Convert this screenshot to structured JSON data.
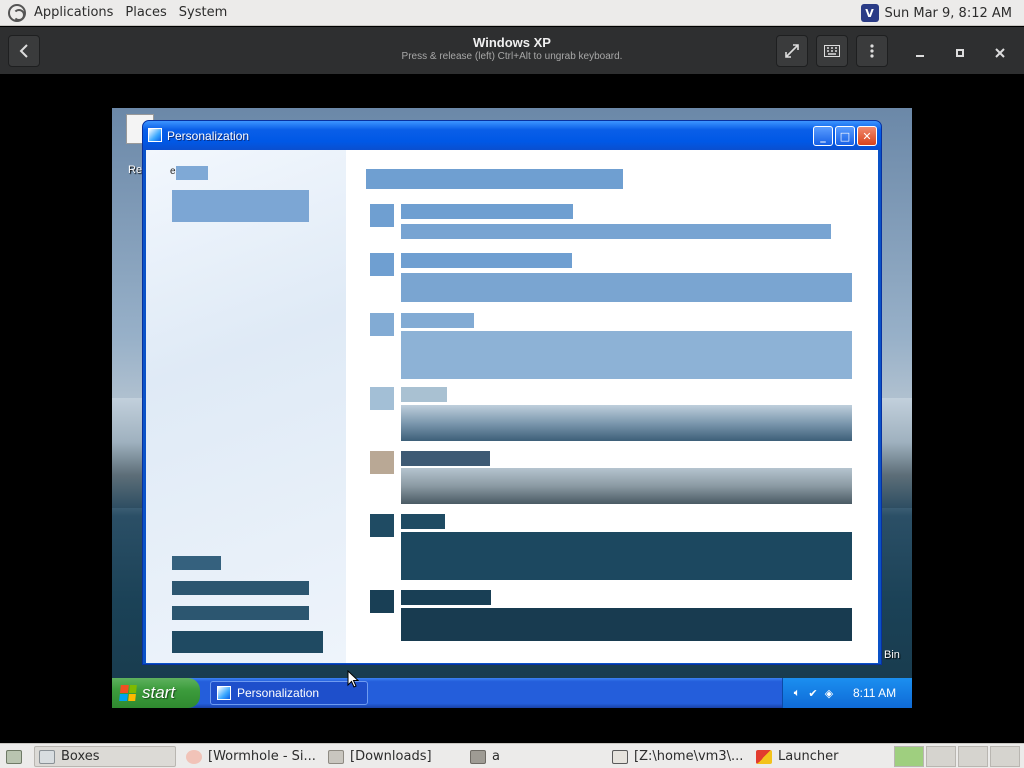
{
  "top_panel": {
    "menus": [
      "Applications",
      "Places",
      "System"
    ],
    "clock": "Sun Mar 9,  8:12 AM"
  },
  "boxes_header": {
    "title": "Windows XP",
    "subtitle": "Press & release (left) Ctrl+Alt to ungrab keyboard.",
    "icons": [
      "back-arrow-icon",
      "fullscreen-icon",
      "keyboard-icon",
      "kebab-menu-icon",
      "minimize-icon",
      "maximize-icon",
      "close-icon"
    ]
  },
  "vm": {
    "desktop_labels": {
      "recycle_left": "Re",
      "recycle_right": "Bin"
    },
    "window": {
      "title": "Personalization",
      "caption_buttons": {
        "minimize": "_",
        "maximize": "□",
        "close": "✕"
      },
      "left_pane_label": "e"
    },
    "taskbar": {
      "start_label": "start",
      "task_button": "Personalization",
      "clock": "8:11 AM"
    }
  },
  "bottom_panel": {
    "tasks": [
      "Boxes",
      "[Wormhole - Si...",
      "[Downloads]",
      "a",
      "[Z:\\home\\vm3\\...",
      "Launcher"
    ]
  },
  "colors": {
    "gnome_panel": "#ecebea",
    "boxes_header": "#2e2f30",
    "xp_blue": "#245edb",
    "xp_start_green": "#3c9c3c",
    "placeholder_blue": "#6f9fd1"
  }
}
